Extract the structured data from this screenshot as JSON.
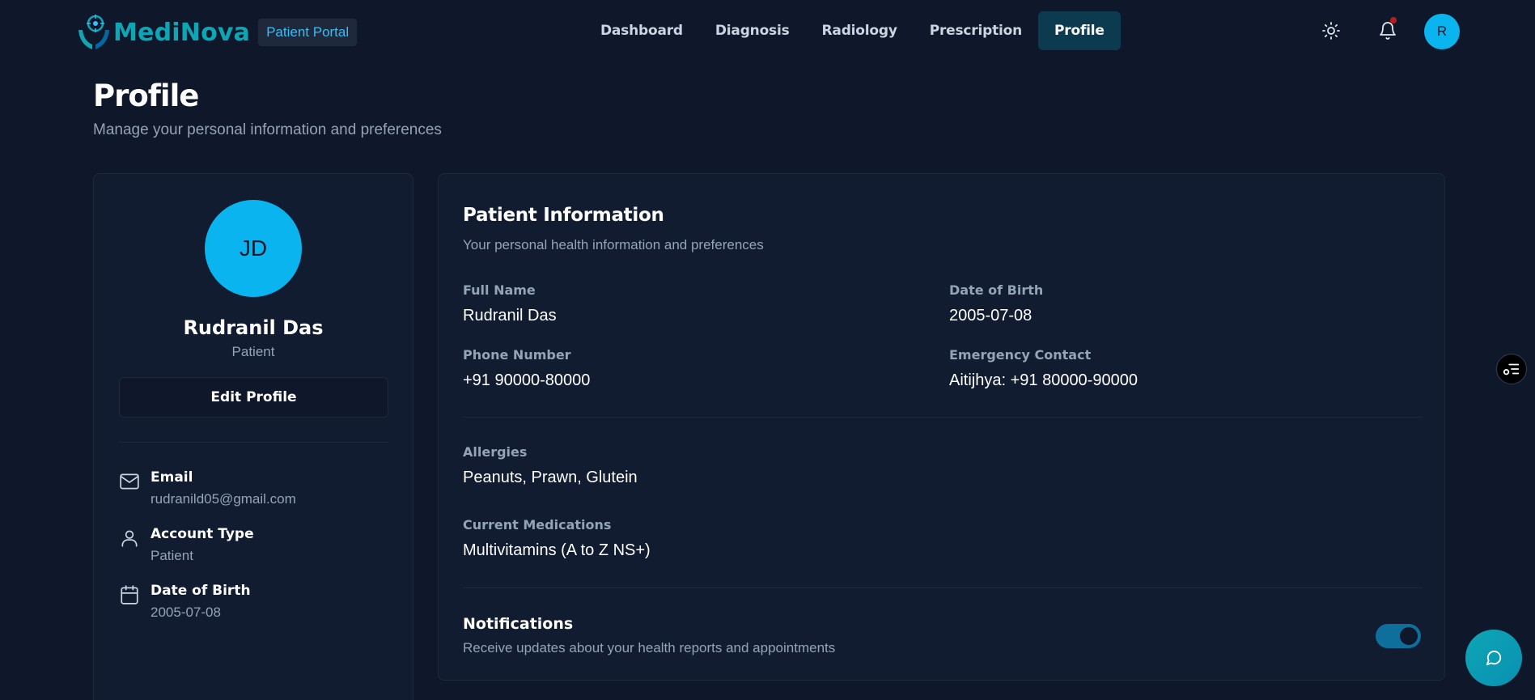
{
  "app": {
    "brand": "MediNova",
    "portal_badge": "Patient Portal",
    "user_initial": "R"
  },
  "nav": {
    "items": [
      {
        "label": "Dashboard",
        "active": false
      },
      {
        "label": "Diagnosis",
        "active": false
      },
      {
        "label": "Radiology",
        "active": false
      },
      {
        "label": "Prescription",
        "active": false
      },
      {
        "label": "Profile",
        "active": true
      }
    ],
    "icons": [
      "sun-icon",
      "bell-icon"
    ]
  },
  "page": {
    "title": "Profile",
    "subtitle": "Manage your personal information and preferences"
  },
  "profile_card": {
    "avatar_initials": "JD",
    "name": "Rudranil Das",
    "role": "Patient",
    "edit_label": "Edit Profile",
    "details": [
      {
        "icon": "mail-icon",
        "label": "Email",
        "value": "rudranild05@gmail.com"
      },
      {
        "icon": "user-icon",
        "label": "Account Type",
        "value": "Patient"
      },
      {
        "icon": "calendar-icon",
        "label": "Date of Birth",
        "value": "2005-07-08"
      }
    ]
  },
  "patient_info": {
    "title": "Patient Information",
    "subtitle": "Your personal health information and preferences",
    "full_name_label": "Full Name",
    "full_name": "Rudranil Das",
    "dob_label": "Date of Birth",
    "dob": "2005-07-08",
    "phone_label": "Phone Number",
    "phone": "+91 90000-80000",
    "emergency_label": "Emergency Contact",
    "emergency": "Aitijhya: +91 80000-90000",
    "allergies_label": "Allergies",
    "allergies": "Peanuts, Prawn, Glutein",
    "medications_label": "Current Medications",
    "medications": "Multivitamins (A to Z NS+)",
    "notifications_title": "Notifications",
    "notifications_sub": "Receive updates about your health reports and appointments",
    "notifications_enabled": true
  },
  "colors": {
    "background": "#0f172a",
    "card": "#111c31",
    "accent": "#0ab5ef",
    "brand": "#0ea5b5",
    "active_nav": "#0c3a4f"
  }
}
